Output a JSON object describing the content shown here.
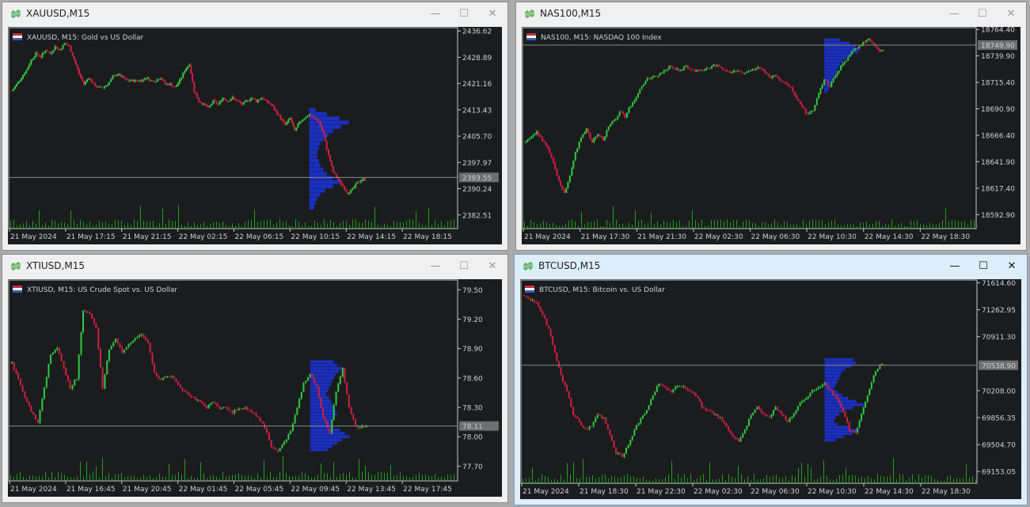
{
  "colors": {
    "up": "#2ecc40",
    "down": "#d02040",
    "volume": "#1ea01e",
    "profile": "#1a2fc0",
    "grid": "#888888",
    "frame": "#c8c8c8",
    "bg": "#1b1c1e"
  },
  "windows": [
    {
      "title": "XAUUSD,M15",
      "legend": "XAUUSD, M15:  Gold vs US Dollar",
      "current_price": "2393.55",
      "chart_data": {
        "type": "candlestick",
        "ylim": [
          2378.5,
          2437.6
        ],
        "y_ticks": [
          "2436.62",
          "2428.89",
          "2421.16",
          "2413.43",
          "2405.70",
          "2397.97",
          "2390.24",
          "2382.51"
        ],
        "x_labels": [
          "21 May 2024",
          "21 May 17:15",
          "21 May 21:15",
          "22 May 02:15",
          "22 May 06:15",
          "22 May 10:15",
          "22 May 14:15",
          "22 May 18:15"
        ],
        "close_path": [
          2419,
          2421,
          2423,
          2425,
          2428,
          2430,
          2429,
          2431,
          2430,
          2432,
          2431,
          2433,
          2432,
          2428,
          2424,
          2421,
          2423,
          2421,
          2420,
          2420,
          2421,
          2423,
          2424,
          2423,
          2422,
          2422,
          2422,
          2422,
          2423,
          2422,
          2422,
          2423,
          2421,
          2421,
          2420,
          2422,
          2425,
          2427,
          2419,
          2416,
          2415,
          2414,
          2416,
          2415,
          2417,
          2416,
          2417,
          2416,
          2415,
          2416,
          2417,
          2416,
          2417,
          2416,
          2415,
          2413,
          2411,
          2409,
          2411,
          2407,
          2410,
          2411,
          2412,
          2411,
          2410,
          2406,
          2400,
          2395,
          2393,
          2391,
          2389,
          2390,
          2392,
          2393
        ],
        "profile_top": 2414,
        "profile_bottom": 2384,
        "volume_profile": [
          8,
          22,
          38,
          50,
          40,
          30,
          24,
          18,
          14,
          12,
          10,
          10,
          12,
          14,
          18,
          22,
          30,
          38,
          30,
          20,
          14,
          10,
          8,
          6
        ]
      }
    },
    {
      "title": "NAS100,M15",
      "legend": "NAS100, M15:  NASDAQ 100 Index",
      "current_price": "18749.90",
      "chart_data": {
        "type": "candlestick",
        "ylim": [
          18580,
          18766
        ],
        "y_ticks": [
          "18764.40",
          "18739.90",
          "18715.40",
          "18690.90",
          "18666.40",
          "18641.90",
          "18617.40",
          "18592.90"
        ],
        "x_labels": [
          "21 May 2024",
          "21 May 17:30",
          "21 May 21:30",
          "22 May 02:30",
          "22 May 06:30",
          "22 May 10:30",
          "22 May 14:30",
          "22 May 18:30"
        ],
        "close_path": [
          18660,
          18665,
          18670,
          18662,
          18655,
          18640,
          18625,
          18612,
          18630,
          18650,
          18665,
          18672,
          18660,
          18668,
          18662,
          18675,
          18680,
          18688,
          18684,
          18694,
          18702,
          18712,
          18718,
          18720,
          18722,
          18726,
          18730,
          18728,
          18726,
          18730,
          18727,
          18726,
          18727,
          18728,
          18732,
          18730,
          18727,
          18724,
          18726,
          18724,
          18725,
          18727,
          18729,
          18727,
          18720,
          18722,
          18717,
          18714,
          18710,
          18700,
          18693,
          18685,
          18690,
          18705,
          18718,
          18712,
          18722,
          18730,
          18736,
          18744,
          18748,
          18752,
          18755,
          18750,
          18745
        ],
        "profile_top": 18756,
        "profile_bottom": 18705,
        "volume_profile": [
          20,
          32,
          40,
          45,
          42,
          35,
          28,
          24,
          20,
          18,
          16,
          15,
          14,
          12,
          10,
          8,
          6,
          4
        ]
      }
    },
    {
      "title": "XTIUSD,M15",
      "legend": "XTIUSD, M15:  US Crude Spot vs. US Dollar",
      "current_price": "78.11",
      "chart_data": {
        "type": "candlestick",
        "ylim": [
          77.55,
          79.6
        ],
        "y_ticks": [
          "79.50",
          "79.20",
          "78.90",
          "78.60",
          "78.30",
          "78.00",
          "77.70"
        ],
        "x_labels": [
          "21 May 2024",
          "21 May 16:45",
          "21 May 20:45",
          "22 May 01:45",
          "22 May 05:45",
          "22 May 09:45",
          "22 May 13:45",
          "22 May 17:45"
        ],
        "close_path": [
          78.75,
          78.6,
          78.4,
          78.25,
          78.15,
          78.5,
          78.85,
          78.9,
          78.7,
          78.5,
          78.6,
          79.3,
          79.25,
          79.1,
          78.5,
          78.9,
          79.0,
          78.85,
          78.95,
          79.0,
          79.05,
          78.95,
          78.65,
          78.58,
          78.62,
          78.6,
          78.5,
          78.45,
          78.4,
          78.35,
          78.3,
          78.35,
          78.3,
          78.3,
          78.25,
          78.28,
          78.3,
          78.25,
          78.2,
          78.1,
          77.9,
          77.85,
          77.95,
          78.05,
          78.3,
          78.55,
          78.65,
          78.5,
          78.2,
          78.05,
          78.45,
          78.7,
          78.3,
          78.1,
          78.11
        ],
        "profile_top": 78.78,
        "profile_bottom": 77.85,
        "volume_profile": [
          30,
          34,
          40,
          36,
          32,
          30,
          28,
          26,
          24,
          22,
          20,
          24,
          26,
          28,
          30,
          32,
          34,
          30,
          28,
          26,
          30,
          38,
          44,
          50,
          40,
          34,
          28,
          22
        ]
      }
    },
    {
      "title": "BTCUSD,M15",
      "legend": "BTCUSD, M15:  Bitcoin vs. US Dollar",
      "current_price": "70538.90",
      "chart_data": {
        "type": "candlestick",
        "ylim": [
          69000,
          71650
        ],
        "y_ticks": [
          "71614.60",
          "71262.95",
          "70911.30",
          "70559.65",
          "70208.00",
          "69856.35",
          "69504.70",
          "69153.05"
        ],
        "x_labels": [
          "21 May 2024",
          "21 May 18:30",
          "21 May 22:30",
          "22 May 02:30",
          "22 May 06:30",
          "22 May 10:30",
          "22 May 14:30",
          "22 May 18:30"
        ],
        "close_path": [
          71450,
          71400,
          71350,
          71200,
          71000,
          70700,
          70400,
          70200,
          69900,
          69800,
          69700,
          69750,
          69900,
          69850,
          69650,
          69400,
          69350,
          69500,
          69700,
          69850,
          69950,
          70150,
          70300,
          70250,
          70200,
          70280,
          70250,
          70200,
          70150,
          70000,
          69950,
          69900,
          69850,
          69750,
          69600,
          69550,
          69700,
          69900,
          70000,
          69900,
          69850,
          70000,
          69900,
          69800,
          69900,
          70050,
          70100,
          70200,
          70250,
          70300,
          70200,
          70100,
          69950,
          69700,
          69650,
          69900,
          70150,
          70400,
          70540
        ],
        "profile_top": 70630,
        "profile_bottom": 69540,
        "volume_profile": [
          36,
          40,
          34,
          26,
          22,
          20,
          18,
          16,
          14,
          12,
          16,
          22,
          30,
          40,
          50,
          36,
          24,
          18,
          14,
          12,
          16,
          30,
          44,
          36,
          24,
          14
        ]
      }
    }
  ]
}
